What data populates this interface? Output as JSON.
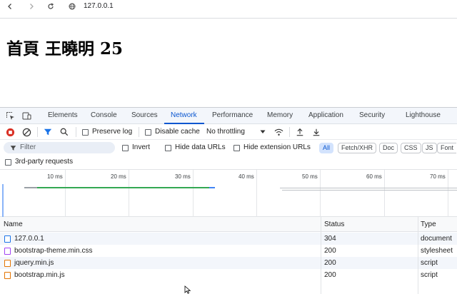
{
  "browser": {
    "url": "127.0.0.1"
  },
  "page": {
    "heading": "首頁 王曉明 25"
  },
  "devtools": {
    "tabs": [
      {
        "label": "Elements"
      },
      {
        "label": "Console"
      },
      {
        "label": "Sources"
      },
      {
        "label": "Network",
        "active": true
      },
      {
        "label": "Performance"
      },
      {
        "label": "Memory"
      },
      {
        "label": "Application"
      },
      {
        "label": "Security"
      },
      {
        "label": "Lighthouse"
      }
    ],
    "toolbar": {
      "preserve_log": "Preserve log",
      "disable_cache": "Disable cache",
      "throttling": "No throttling"
    },
    "filter": {
      "placeholder": "Filter",
      "invert": "Invert",
      "hide_data_urls": "Hide data URLs",
      "hide_extension_urls": "Hide extension URLs",
      "types": [
        "All",
        "Fetch/XHR",
        "Doc",
        "CSS",
        "JS",
        "Font"
      ],
      "third_party": "3rd-party requests"
    },
    "timeline": {
      "ticks": [
        "10 ms",
        "20 ms",
        "30 ms",
        "40 ms",
        "50 ms",
        "60 ms",
        "70 ms"
      ]
    },
    "table": {
      "headers": {
        "name": "Name",
        "status": "Status",
        "type": "Type"
      },
      "rows": [
        {
          "name": "127.0.0.1",
          "status": "304",
          "type": "document",
          "icon": "document-icon"
        },
        {
          "name": "bootstrap-theme.min.css",
          "status": "200",
          "type": "stylesheet",
          "icon": "stylesheet-icon"
        },
        {
          "name": "jquery.min.js",
          "status": "200",
          "type": "script",
          "icon": "script-icon"
        },
        {
          "name": "bootstrap.min.js",
          "status": "200",
          "type": "script",
          "icon": "script-icon"
        }
      ]
    }
  },
  "colors": {
    "accent": "#0b57d0",
    "record_red": "#d93025",
    "filter_blue": "#1a73e8",
    "waterfall_green": "#34a853"
  }
}
